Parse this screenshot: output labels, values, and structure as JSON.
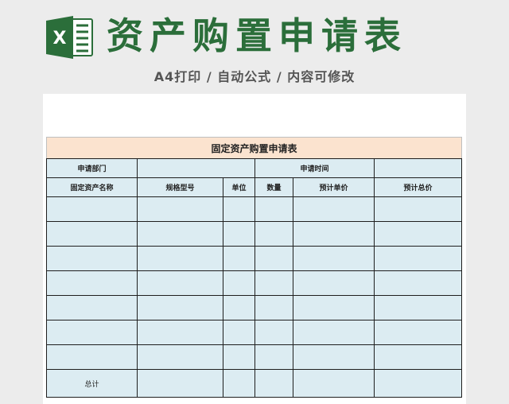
{
  "header": {
    "title": "资产购置申请表",
    "subtitle": "A4打印 / 自动公式 / 内容可修改",
    "logo_letter": "X",
    "brand_color": "#2b6e3a"
  },
  "sheet": {
    "title": "固定资产购置申请表",
    "apply_dept_label": "申请部门",
    "apply_dept_value": "",
    "apply_time_label": "申请时间",
    "apply_time_value": "",
    "columns": [
      "固定资产名称",
      "规格型号",
      "单位",
      "数量",
      "预计单价",
      "预计总价"
    ],
    "rows": [
      [
        "",
        "",
        "",
        "",
        "",
        ""
      ],
      [
        "",
        "",
        "",
        "",
        "",
        ""
      ],
      [
        "",
        "",
        "",
        "",
        "",
        ""
      ],
      [
        "",
        "",
        "",
        "",
        "",
        ""
      ],
      [
        "",
        "",
        "",
        "",
        "",
        ""
      ],
      [
        "",
        "",
        "",
        "",
        "",
        ""
      ],
      [
        "",
        "",
        "",
        "",
        "",
        ""
      ]
    ],
    "total_label": "总计",
    "colors": {
      "title_bg": "#fbe3cf",
      "cell_bg": "#dcecf2",
      "border": "#1f1f1f"
    }
  }
}
